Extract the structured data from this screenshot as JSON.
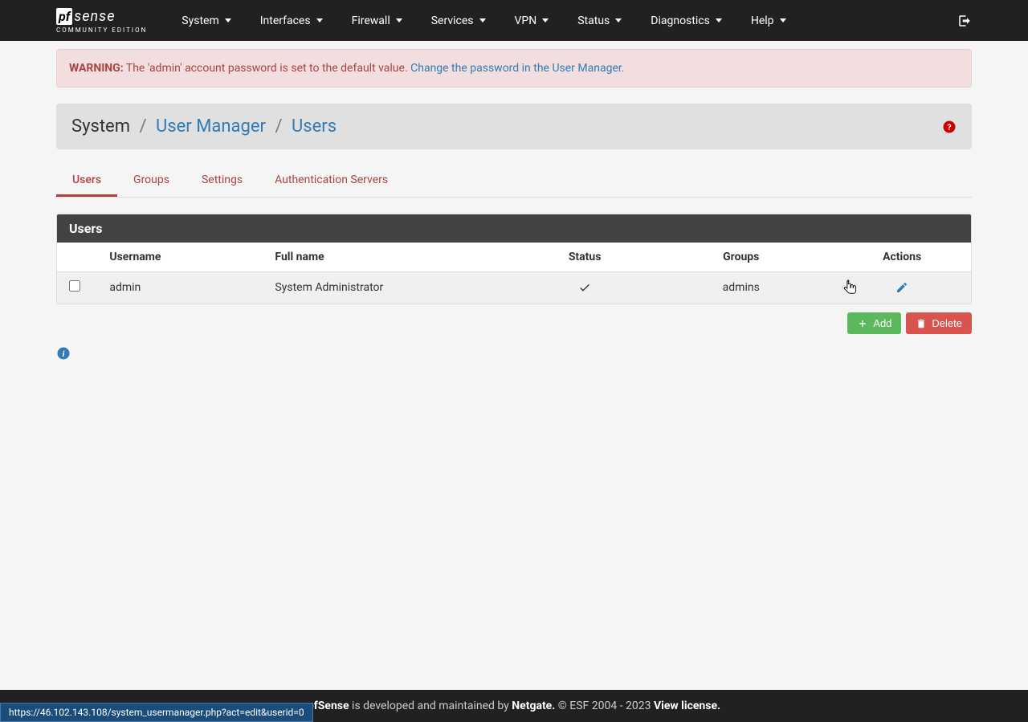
{
  "logo": {
    "pf": "pf",
    "sense": "sense",
    "edition": "COMMUNITY EDITION"
  },
  "nav": {
    "items": [
      "System",
      "Interfaces",
      "Firewall",
      "Services",
      "VPN",
      "Status",
      "Diagnostics",
      "Help"
    ]
  },
  "alert": {
    "warning_label": "WARNING:",
    "text": " The 'admin' account password is set to the default value. ",
    "link_text": "Change the password in the User Manager."
  },
  "breadcrumb": {
    "root": "System",
    "mid": "User Manager",
    "leaf": "Users"
  },
  "tabs": [
    "Users",
    "Groups",
    "Settings",
    "Authentication Servers"
  ],
  "panel": {
    "title": "Users",
    "columns": [
      "",
      "Username",
      "Full name",
      "Status",
      "Groups",
      "Actions"
    ],
    "rows": [
      {
        "username": "admin",
        "fullname": "System Administrator",
        "status_ok": true,
        "groups": "admins"
      }
    ]
  },
  "buttons": {
    "add": "Add",
    "delete": "Delete"
  },
  "footer": {
    "pf": "pfSense",
    "text1": " is developed and maintained by ",
    "netgate": "Netgate.",
    "copyright": " © ESF 2004 - 2023 ",
    "license": "View license."
  },
  "status_bar_url": "https://46.102.143.108/system_usermanager.php?act=edit&userid=0"
}
